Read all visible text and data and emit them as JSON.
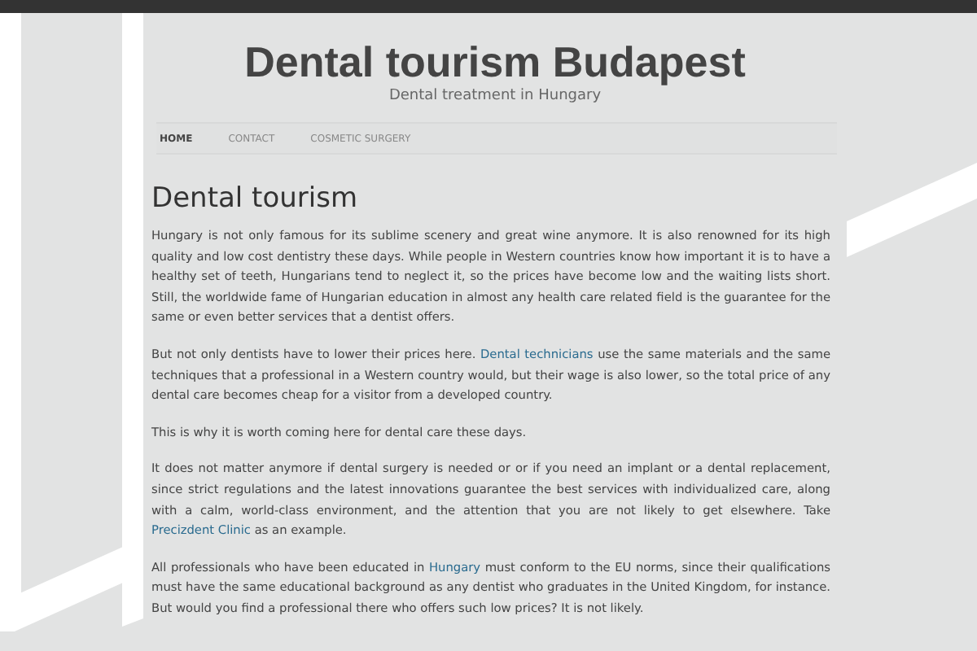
{
  "site": {
    "title": "Dental tourism Budapest",
    "tagline": "Dental treatment in Hungary"
  },
  "nav": [
    {
      "label": "HOME",
      "selected": true
    },
    {
      "label": "CONTACT",
      "selected": false
    },
    {
      "label": "COSMETIC SURGERY",
      "selected": false
    }
  ],
  "article": {
    "heading": "Dental tourism",
    "paragraphs": [
      [
        {
          "kind": "text",
          "text": "Hungary is not only famous for its sublime scenery and great wine anymore. It is also renowned for its high quality and low cost dentistry these days. While people in Western countries know how important it is to have a healthy set of teeth, Hungarians tend to neglect it, so the prices have become low and the waiting lists short. Still, the worldwide fame of Hungarian education in almost any health care related field is the guarantee for the same or even better services that a dentist offers."
        }
      ],
      [
        {
          "kind": "text",
          "text": "But not only dentists have to lower their prices here. "
        },
        {
          "kind": "link",
          "text": "Dental technicians"
        },
        {
          "kind": "text",
          "text": " use the same materials and the same techniques that a professional in a Western country would, but their wage is also lower, so the total price of any dental care becomes cheap for a visitor from a developed country."
        }
      ],
      [
        {
          "kind": "text",
          "text": "This is why it is worth coming here for dental care these days."
        }
      ],
      [
        {
          "kind": "text",
          "text": "It does not matter anymore if dental surgery is needed or or if you need an implant or a dental replacement, since strict regulations and the latest innovations guarantee the best services with individualized care, along with a calm, world-class environment, and the attention that you are not likely to get elsewhere. Take "
        },
        {
          "kind": "link",
          "text": "Precizdent Clinic"
        },
        {
          "kind": "text",
          "text": " as an example."
        }
      ],
      [
        {
          "kind": "text",
          "text": "All professionals who have been educated in "
        },
        {
          "kind": "link",
          "text": "Hungary"
        },
        {
          "kind": "text",
          "text": " must conform to the EU norms, since their qualifications must have the same educational background as any dentist who graduates in the United Kingdom, for instance. But would you find a professional there who offers such low prices? It is not likely."
        }
      ]
    ]
  }
}
